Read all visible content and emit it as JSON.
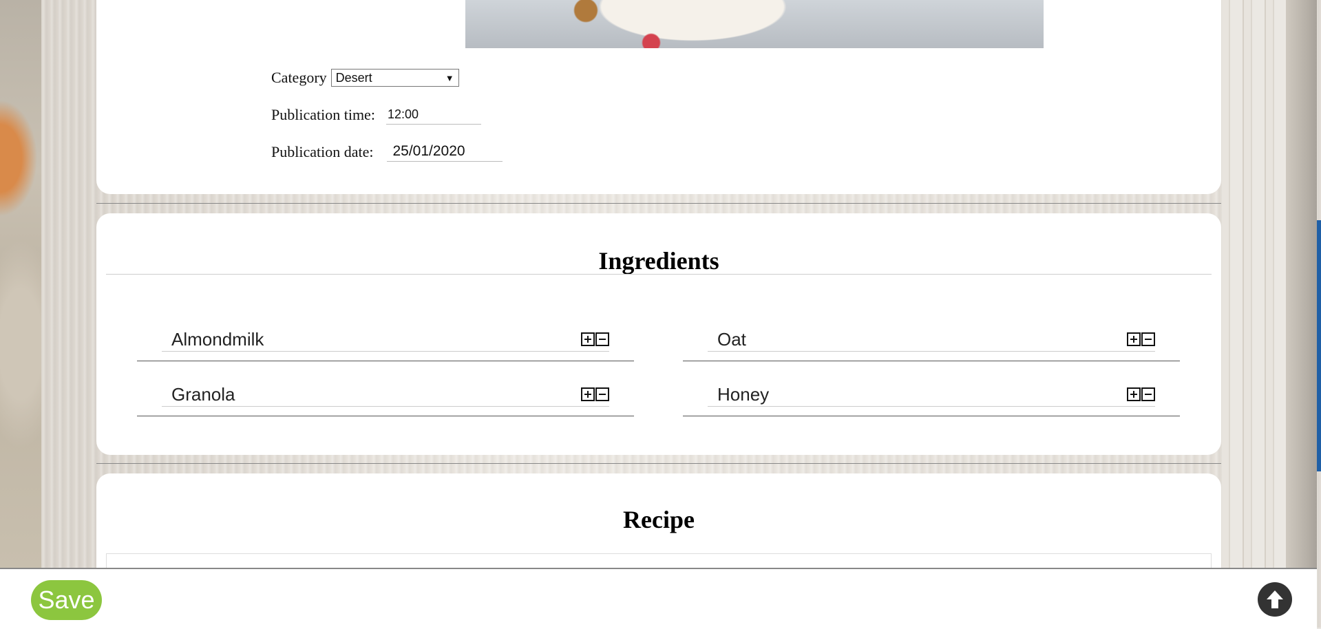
{
  "form": {
    "category_label": "Category",
    "category_value": "Desert",
    "time_label": "Publication time:",
    "time_value": "12:00",
    "date_label": "Publication date:",
    "date_value": "25/01/2020"
  },
  "ingredients": {
    "title": "Ingredients",
    "items": [
      {
        "name": "Almondmilk"
      },
      {
        "name": "Oat"
      },
      {
        "name": "Granola"
      },
      {
        "name": "Honey"
      }
    ]
  },
  "recipe": {
    "title": "Recipe"
  },
  "footer": {
    "save_label": "Save"
  },
  "colors": {
    "save": "#8cc63f",
    "scroll_up": "#333333"
  },
  "icons": [
    "plus-icon",
    "minus-icon",
    "arrow-up-icon",
    "chevron-down-icon"
  ]
}
